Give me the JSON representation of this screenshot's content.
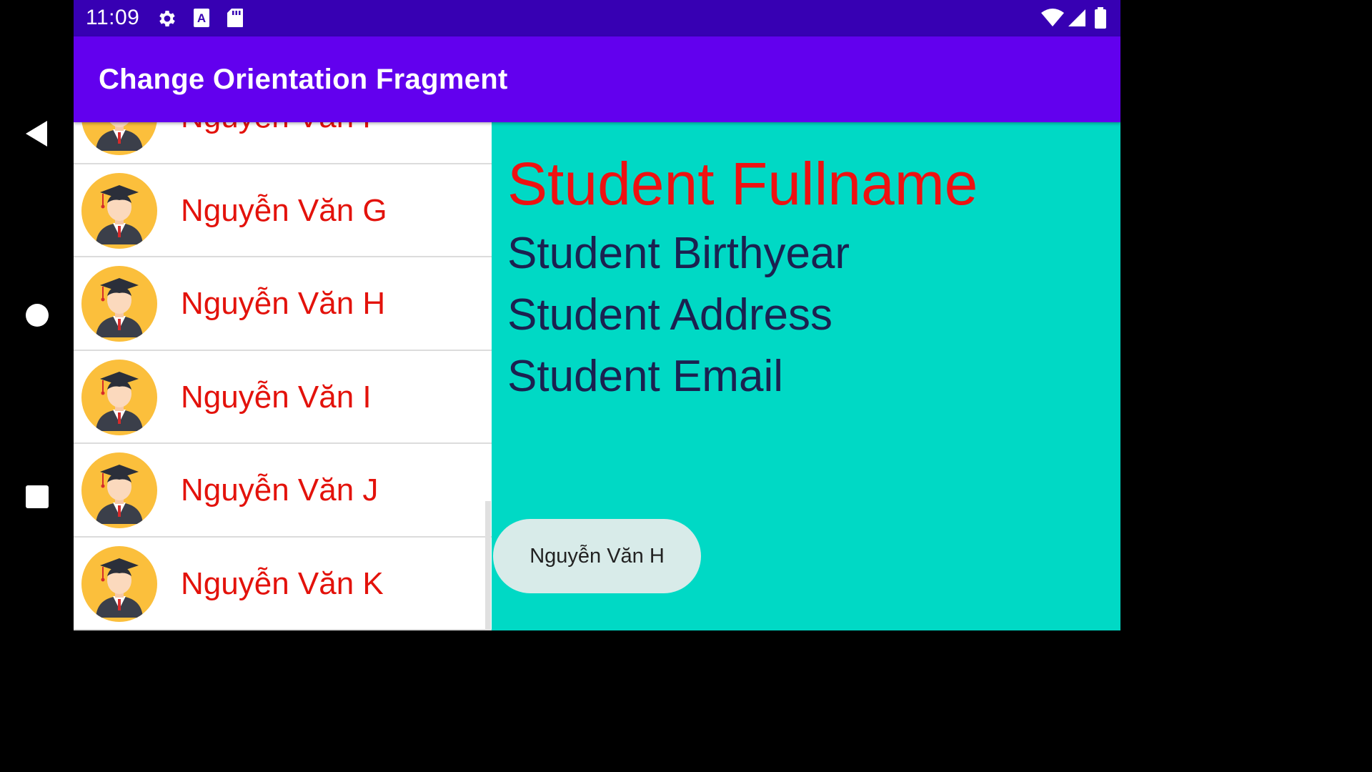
{
  "status_bar": {
    "time": "11:09",
    "left_icons": [
      "gear-icon",
      "text-a-icon",
      "sd-card-icon"
    ],
    "right_icons": [
      "wifi-icon",
      "signal-icon",
      "battery-icon"
    ],
    "bg_color": "#3700b3"
  },
  "app_bar": {
    "title": "Change Orientation Fragment",
    "bg_color": "#6200ee"
  },
  "student_list": {
    "items": [
      {
        "name": "Nguyễn Văn F"
      },
      {
        "name": "Nguyễn Văn G"
      },
      {
        "name": "Nguyễn Văn H"
      },
      {
        "name": "Nguyễn Văn I"
      },
      {
        "name": "Nguyễn Văn J"
      },
      {
        "name": "Nguyễn Văn K"
      }
    ],
    "name_color": "#e3120b",
    "avatar_icon": "graduate-avatar-icon"
  },
  "detail": {
    "fullname": "Student Fullname",
    "birthyear": "Student Birthyear",
    "address": "Student Address",
    "email": "Student Email",
    "bg_color": "#00d9c5"
  },
  "toast": {
    "text": "Nguyễn Văn H"
  },
  "navigation": {
    "buttons": [
      "back-icon",
      "home-icon",
      "recents-icon"
    ]
  }
}
